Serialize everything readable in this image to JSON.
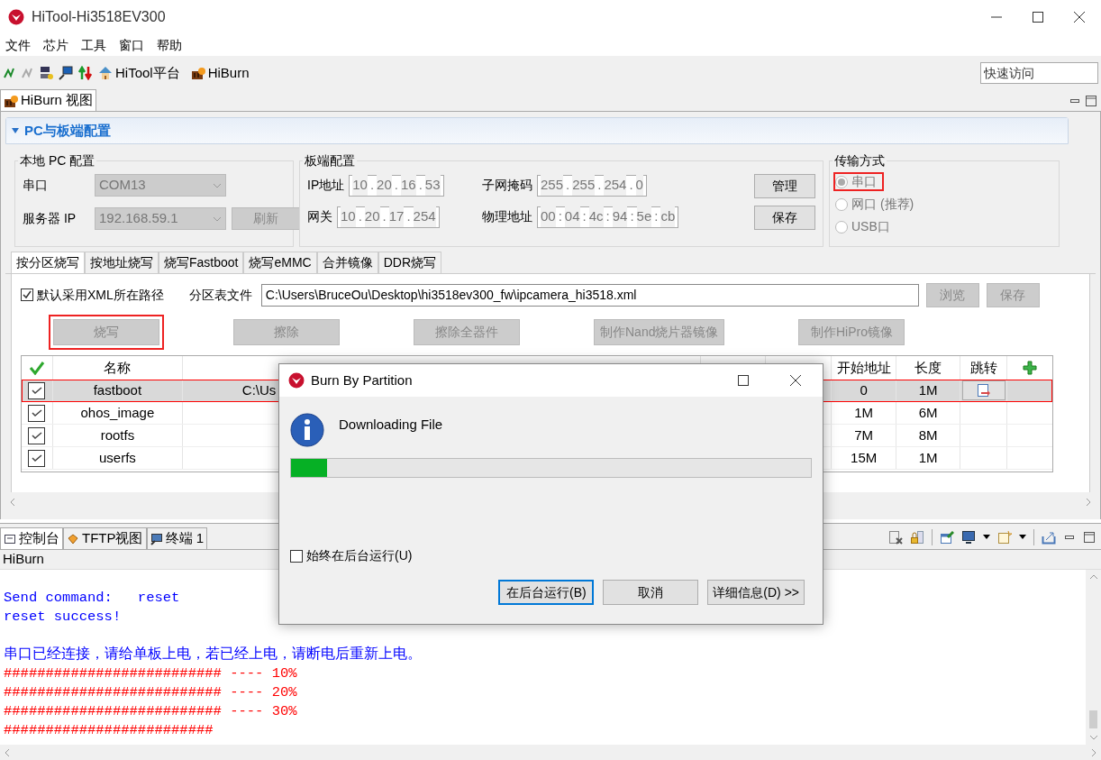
{
  "window": {
    "title": "HiTool-Hi3518EV300"
  },
  "menu": [
    "文件",
    "芯片",
    "工具",
    "窗口",
    "帮助"
  ],
  "toolbar": {
    "links": [
      "HiTool平台",
      "HiBurn"
    ],
    "quick_access": {
      "placeholder": "快速访问"
    }
  },
  "view_tab": {
    "label": "HiBurn 视图",
    "selected": true
  },
  "section": {
    "title": "PC与板端配置",
    "expanded": true
  },
  "local_pc": {
    "title": "本地 PC 配置",
    "fields": [
      {
        "label": "串口",
        "value": "COM13"
      },
      {
        "label": "服务器 IP",
        "value": "192.168.59.1"
      }
    ],
    "refresh_button": "刷新"
  },
  "board": {
    "title": "板端配置",
    "fields": [
      {
        "label": "IP地址",
        "separator": ".",
        "parts": [
          "10",
          "20",
          "16",
          "53"
        ]
      },
      {
        "label": "子网掩码",
        "separator": ".",
        "parts": [
          "255",
          "255",
          "254",
          "0"
        ]
      },
      {
        "label": "网关",
        "separator": ".",
        "parts": [
          "10",
          "20",
          "17",
          "254"
        ]
      },
      {
        "label": "物理地址",
        "separator": ":",
        "parts": [
          "00",
          "04",
          "4c",
          "94",
          "5e",
          "cb"
        ]
      }
    ],
    "buttons": [
      "管理",
      "保存"
    ]
  },
  "transfer": {
    "title": "传输方式",
    "options": [
      {
        "label": "串口",
        "selected": true,
        "disabled": true,
        "highlighted": true
      },
      {
        "label": "网口 (推荐)",
        "selected": false,
        "disabled": true,
        "highlighted": false
      },
      {
        "label": "USB口",
        "selected": false,
        "disabled": true,
        "highlighted": false
      }
    ]
  },
  "burn_tabs": [
    {
      "label": "按分区烧写",
      "selected": true
    },
    {
      "label": "按地址烧写",
      "selected": false
    },
    {
      "label": "烧写Fastboot",
      "selected": false
    },
    {
      "label": "烧写eMMC",
      "selected": false
    },
    {
      "label": "合并镜像",
      "selected": false
    },
    {
      "label": "DDR烧写",
      "selected": false
    }
  ],
  "options": {
    "use_xml_path": {
      "label": "默认采用XML所在路径",
      "checked": true
    },
    "partition_label": "分区表文件",
    "partition_file": "C:\\Users\\BruceOu\\Desktop\\hi3518ev300_fw\\ipcamera_hi3518.xml",
    "buttons": [
      {
        "label": "浏览",
        "disabled": true
      },
      {
        "label": "保存",
        "disabled": true
      }
    ]
  },
  "actions": [
    {
      "label": "烧写",
      "disabled": true,
      "highlighted": true
    },
    {
      "label": "擦除",
      "disabled": true,
      "highlighted": false
    },
    {
      "label": "擦除全器件",
      "disabled": true,
      "highlighted": false
    },
    {
      "label": "制作Nand烧片器镜像",
      "disabled": true,
      "highlighted": false
    },
    {
      "label": "制作HiPro镜像",
      "disabled": true,
      "highlighted": false
    }
  ],
  "table": {
    "columns": {
      "name": "名称",
      "start": "开始地址",
      "length": "长度",
      "jump": "跳转"
    },
    "rows": [
      {
        "checked": true,
        "name": "fastboot",
        "column_3": "C:\\Us",
        "start": "0",
        "length": "1M",
        "jump": true,
        "selected": true,
        "highlighted": true
      },
      {
        "checked": true,
        "name": "ohos_image",
        "start": "1M",
        "length": "6M",
        "jump": false,
        "selected": false,
        "highlighted": false
      },
      {
        "checked": true,
        "name": "rootfs",
        "start": "7M",
        "length": "8M",
        "jump": false,
        "selected": false,
        "highlighted": false
      },
      {
        "checked": true,
        "name": "userfs",
        "start": "15M",
        "length": "1M",
        "jump": false,
        "selected": false,
        "highlighted": false
      }
    ]
  },
  "console_tabs": [
    {
      "label": "控制台",
      "selected": true
    },
    {
      "label": "TFTP视图",
      "selected": false
    },
    {
      "label": "终端 1",
      "selected": false
    }
  ],
  "console": {
    "title": "HiBurn",
    "lines": [
      {
        "text": "Send command:   reset",
        "color": "#0000ff"
      },
      {
        "text": "reset success!",
        "color": "#0000ff"
      },
      {
        "text": "串口已经连接，请给单板上电，若已经上电，请断电后重新上电。",
        "color": "#0000ff"
      },
      {
        "text": "########################## ---- 10%",
        "color": "#ff0000"
      },
      {
        "text": "########################## ---- 20%",
        "color": "#ff0000"
      },
      {
        "text": "########################## ---- 30%",
        "color": "#ff0000"
      },
      {
        "text": "#########################",
        "color": "#ff0000"
      }
    ]
  },
  "dialog": {
    "title": "Burn By Partition",
    "message": "Downloading File",
    "progress": {
      "level": 0.07
    },
    "background_option": {
      "label": "始终在后台运行(U)",
      "checked": false
    },
    "buttons": [
      {
        "label": "在后台运行(B)",
        "selected": true
      },
      {
        "label": "取消",
        "selected": false
      },
      {
        "label": "详细信息(D) >>",
        "selected": false
      }
    ]
  }
}
